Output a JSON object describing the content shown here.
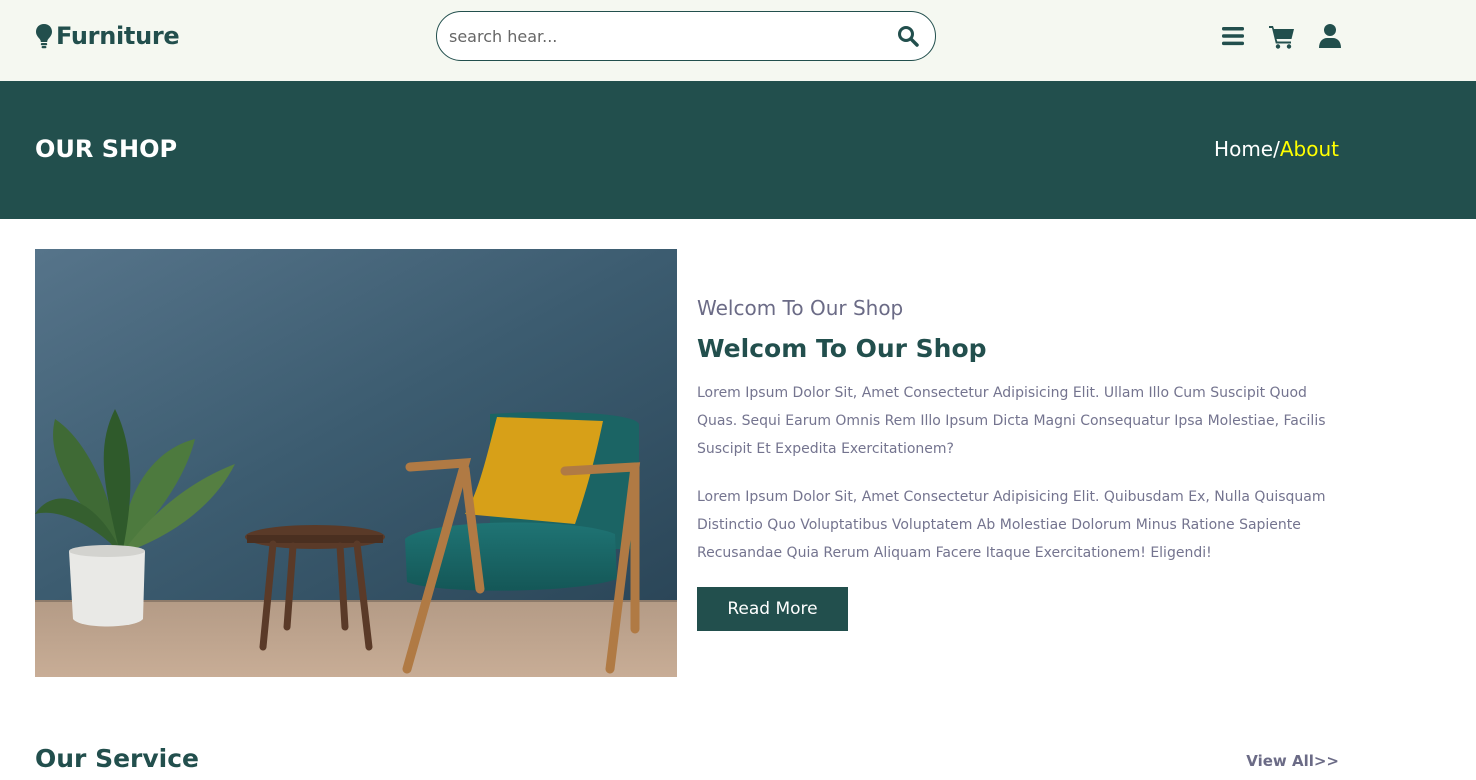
{
  "header": {
    "logo_text": "Furniture",
    "search": {
      "placeholder": "search hear...",
      "value": ""
    },
    "icons": [
      "search-icon",
      "menu-icon",
      "cart-icon",
      "user-icon"
    ]
  },
  "banner": {
    "title": "OUR SHOP",
    "breadcrumb": {
      "home": "Home",
      "separator": "/",
      "current": "About"
    }
  },
  "about": {
    "subtitle": "Welcom To Our Shop",
    "title": "Welcom To Our Shop",
    "paragraphs": [
      "Lorem Ipsum Dolor Sit, Amet Consectetur Adipisicing Elit. Ullam Illo Cum Suscipit Quod Quas. Sequi Earum Omnis Rem Illo Ipsum Dicta Magni Consequatur Ipsa Molestiae, Facilis Suscipit Et Expedita Exercitationem?",
      "Lorem Ipsum Dolor Sit, Amet Consectetur Adipisicing Elit. Quibusdam Ex, Nulla Quisquam Distinctio Quo Voluptatibus Voluptatem Ab Molestiae Dolorum Minus Ratione Sapiente Recusandae Quia Rerum Aliquam Facere Itaque Exercitationem! Eligendi!"
    ],
    "button_label": "Read More"
  },
  "services": {
    "title": "Our Service",
    "view_all": "View All>>"
  },
  "colors": {
    "primary": "#224f4d",
    "header_bg": "#f5f8f1",
    "breadcrumb_active": "#ffff00",
    "muted_text": "#74748f"
  }
}
